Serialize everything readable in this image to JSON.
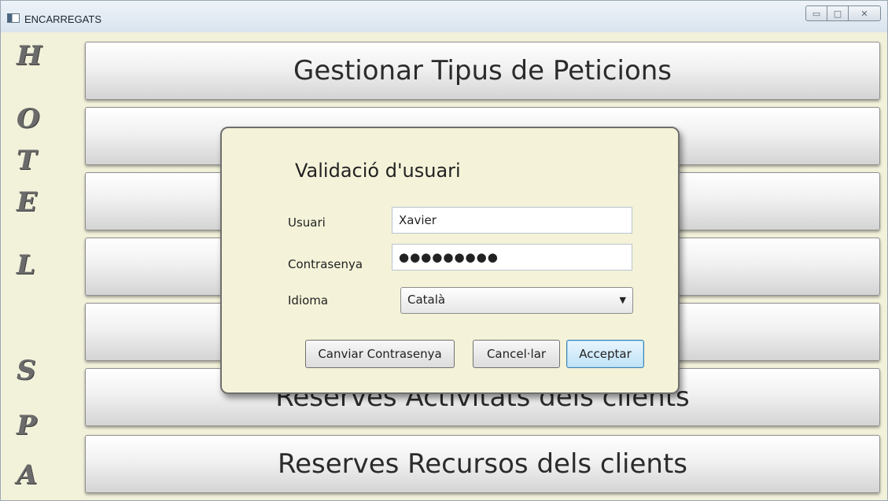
{
  "window": {
    "title": "ENCARREGATS"
  },
  "side_letters": [
    "H",
    "O",
    "T",
    "E",
    "L",
    "S",
    "P",
    "A"
  ],
  "menu": {
    "buttons": [
      "Gestionar Tipus de Peticions",
      "",
      "",
      "",
      "",
      "Reserves Activitats dels clients",
      "Reserves Recursos dels clients"
    ]
  },
  "dialog": {
    "title": "Validació d'usuari",
    "user_label": "Usuari",
    "user_value": "Xavier",
    "password_label": "Contrasenya",
    "password_value": "●●●●●●●●●",
    "language_label": "Idioma",
    "language_value": "Català",
    "change_password_button": "Canviar Contrasenya",
    "cancel_button": "Cancel·lar",
    "accept_button": "Acceptar"
  }
}
